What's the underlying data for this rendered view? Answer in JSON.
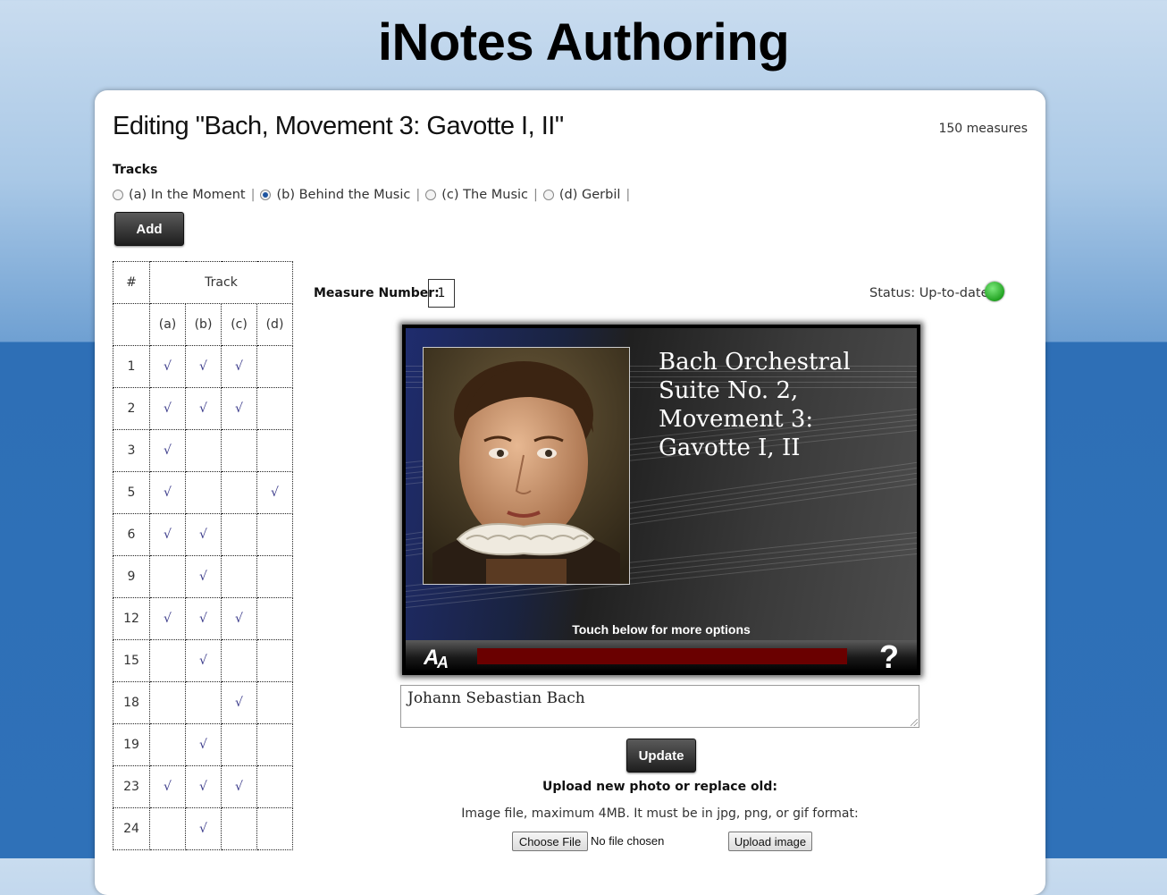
{
  "app_title": "iNotes Authoring",
  "page": {
    "title": "Editing \"Bach, Movement 3: Gavotte I, II\"",
    "measures_count": "150 measures"
  },
  "tracks": {
    "heading": "Tracks",
    "options": [
      {
        "label": "(a) In the Moment",
        "selected": false
      },
      {
        "label": "(b) Behind the Music",
        "selected": true
      },
      {
        "label": "(c) The Music",
        "selected": false
      },
      {
        "label": "(d) Gerbil",
        "selected": false
      }
    ],
    "separator": "|",
    "add_label": "Add"
  },
  "table": {
    "col_num": "#",
    "col_track": "Track",
    "subcols": [
      "(a)",
      "(b)",
      "(c)",
      "(d)"
    ],
    "check": "√",
    "rows": [
      {
        "n": "1",
        "a": true,
        "b": true,
        "c": true,
        "d": false
      },
      {
        "n": "2",
        "a": true,
        "b": true,
        "c": true,
        "d": false
      },
      {
        "n": "3",
        "a": true,
        "b": false,
        "c": false,
        "d": false
      },
      {
        "n": "5",
        "a": true,
        "b": false,
        "c": false,
        "d": true
      },
      {
        "n": "6",
        "a": true,
        "b": true,
        "c": false,
        "d": false
      },
      {
        "n": "9",
        "a": false,
        "b": true,
        "c": false,
        "d": false
      },
      {
        "n": "12",
        "a": true,
        "b": true,
        "c": true,
        "d": false
      },
      {
        "n": "15",
        "a": false,
        "b": true,
        "c": false,
        "d": false
      },
      {
        "n": "18",
        "a": false,
        "b": false,
        "c": true,
        "d": false
      },
      {
        "n": "19",
        "a": false,
        "b": true,
        "c": false,
        "d": false
      },
      {
        "n": "23",
        "a": true,
        "b": true,
        "c": true,
        "d": false
      },
      {
        "n": "24",
        "a": false,
        "b": true,
        "c": false,
        "d": false
      }
    ]
  },
  "measure": {
    "label": "Measure Number:",
    "value": "1"
  },
  "status": {
    "text": "Status: Up-to-date",
    "color": "#22a322"
  },
  "preview": {
    "title": "Bach Orchestral Suite No. 2, Movement 3: Gavotte I, II",
    "touch_text": "Touch below for more options",
    "font_icon": "font-size-icon",
    "help_icon": "help-icon",
    "help_glyph": "?",
    "progress_color": "#6a0000",
    "progress": 0
  },
  "caption": {
    "value": "Johann Sebastian Bach"
  },
  "update_label": "Update",
  "upload": {
    "heading": "Upload new photo or replace old:",
    "note": "Image file, maximum 4MB. It must be in jpg, png, or gif format:",
    "choose_label": "Choose File",
    "file_status": "No file chosen",
    "upload_label": "Upload image"
  }
}
